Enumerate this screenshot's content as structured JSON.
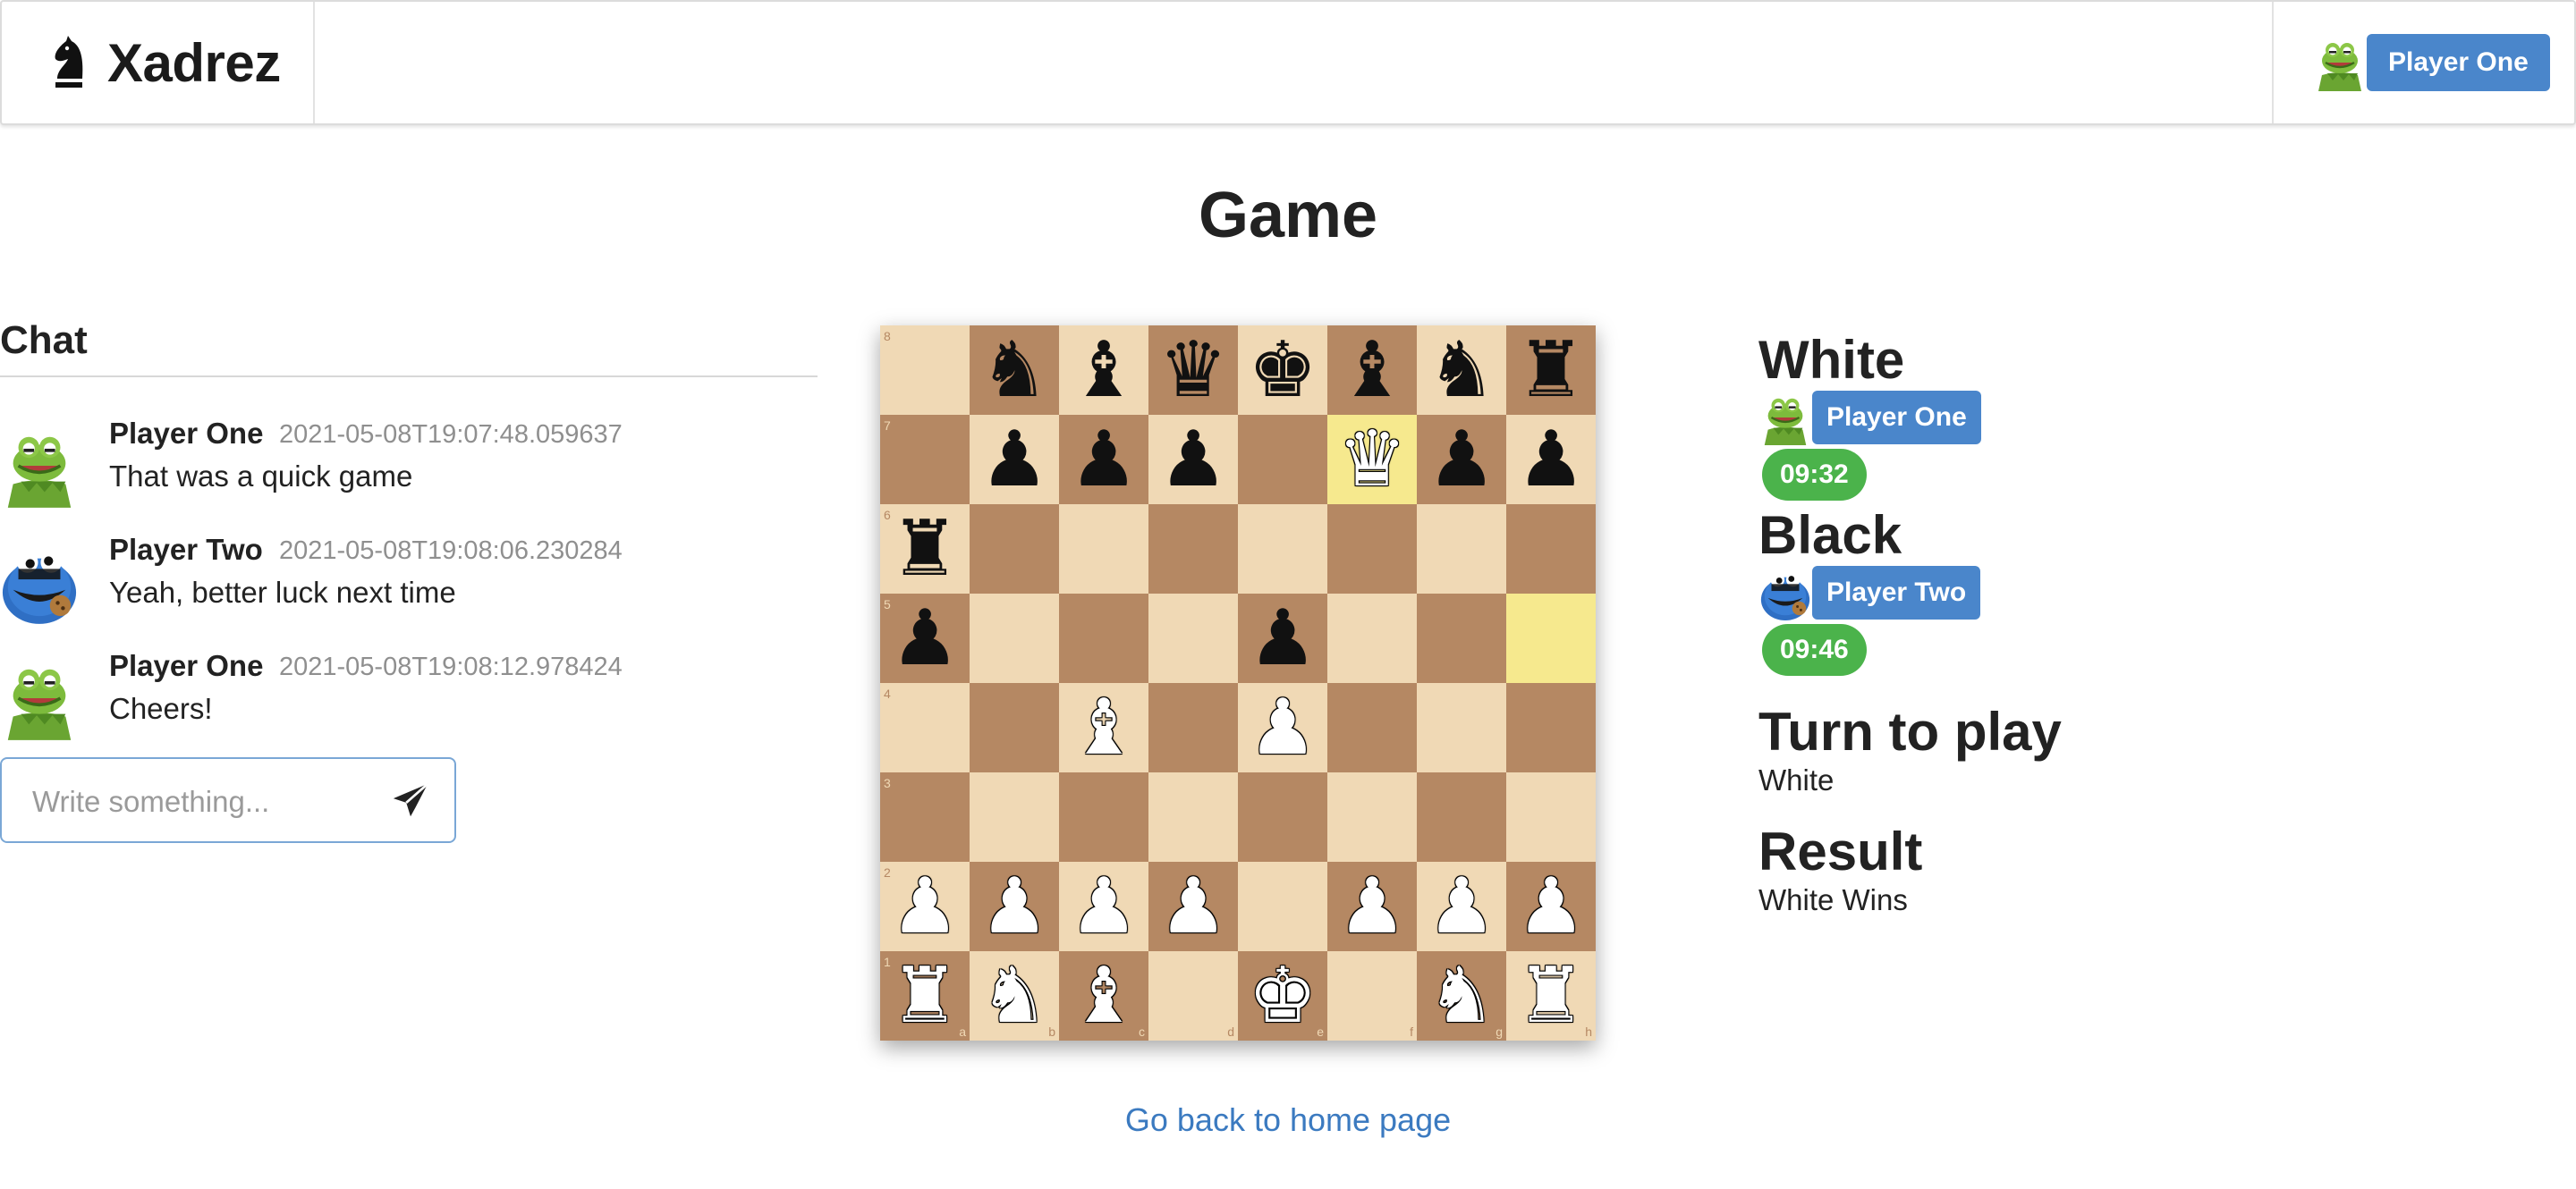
{
  "app": {
    "name": "Xadrez",
    "logo_icon": "chess-knight-icon"
  },
  "navbar": {
    "user": {
      "name": "Player One",
      "avatar": "kermit-avatar"
    }
  },
  "page": {
    "title": "Game",
    "back_link": "Go back to home page"
  },
  "chat": {
    "title": "Chat",
    "messages": [
      {
        "author": "Player One",
        "timestamp": "2021-05-08T19:07:48.059637",
        "text": "That was a quick game",
        "avatar": "kermit-avatar"
      },
      {
        "author": "Player Two",
        "timestamp": "2021-05-08T19:08:06.230284",
        "text": "Yeah, better luck next time",
        "avatar": "cookie-monster-avatar"
      },
      {
        "author": "Player One",
        "timestamp": "2021-05-08T19:08:12.978424",
        "text": "Cheers!",
        "avatar": "kermit-avatar"
      }
    ],
    "input_placeholder": "Write something...",
    "input_value": "",
    "send_icon": "paper-plane-icon"
  },
  "board": {
    "ranks": [
      [
        "",
        "bN",
        "bB",
        "bQ",
        "bK",
        "bB",
        "bN",
        "bR"
      ],
      [
        "",
        "bP",
        "bP",
        "bP",
        "",
        "wQ",
        "bP",
        "bP"
      ],
      [
        "bR",
        "",
        "",
        "",
        "",
        "",
        "",
        ""
      ],
      [
        "bP",
        "",
        "",
        "",
        "bP",
        "",
        "",
        ""
      ],
      [
        "",
        "",
        "wB",
        "",
        "wP",
        "",
        "",
        ""
      ],
      [
        "",
        "",
        "",
        "",
        "",
        "",
        "",
        ""
      ],
      [
        "wP",
        "wP",
        "wP",
        "wP",
        "",
        "wP",
        "wP",
        "wP"
      ],
      [
        "wR",
        "wN",
        "wB",
        "",
        "wK",
        "",
        "wN",
        "wR"
      ]
    ],
    "rank_labels": [
      "8",
      "7",
      "6",
      "5",
      "4",
      "3",
      "2",
      "1"
    ],
    "file_labels": [
      "a",
      "b",
      "c",
      "d",
      "e",
      "f",
      "g",
      "h"
    ],
    "highlighted_squares": [
      "f7",
      "h5"
    ],
    "colors": {
      "light": "#f0d9b5",
      "dark": "#b58863",
      "highlight": "#f6e98e"
    }
  },
  "info": {
    "white": {
      "heading": "White",
      "player": "Player One",
      "avatar": "kermit-avatar",
      "clock": "09:32"
    },
    "black": {
      "heading": "Black",
      "player": "Player Two",
      "avatar": "cookie-monster-avatar",
      "clock": "09:46"
    },
    "turn": {
      "label": "Turn to play",
      "value": "White"
    },
    "result": {
      "label": "Result",
      "value": "White Wins"
    }
  },
  "theme": {
    "accent": "#4a86cb",
    "clock_green": "#4bb34b",
    "link": "#3b7ac0"
  }
}
